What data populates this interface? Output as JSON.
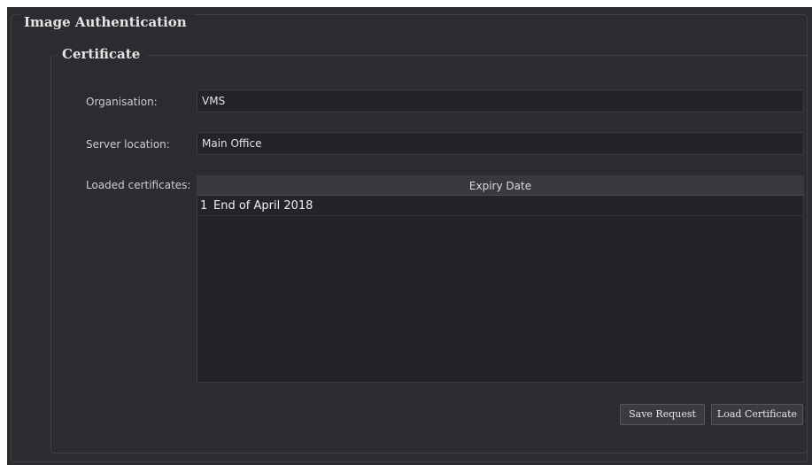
{
  "group": {
    "title": "Image Authentication"
  },
  "certificate": {
    "title": "Certificate",
    "organisation": {
      "label": "Organisation:",
      "value": "VMS"
    },
    "server_location": {
      "label": "Server location:",
      "value": "Main Office"
    },
    "loaded_certificates": {
      "label": "Loaded certificates:",
      "columns": [
        "Expiry Date"
      ],
      "rows": [
        {
          "index": "1",
          "expiry_date": "End of April 2018"
        }
      ]
    },
    "buttons": {
      "save_request": "Save Request",
      "load_certificate": "Load Certificate"
    }
  },
  "colors": {
    "background": "#2b2b30",
    "input_background": "#242428",
    "header_background": "#38383e",
    "button_background": "#3a3a40"
  }
}
